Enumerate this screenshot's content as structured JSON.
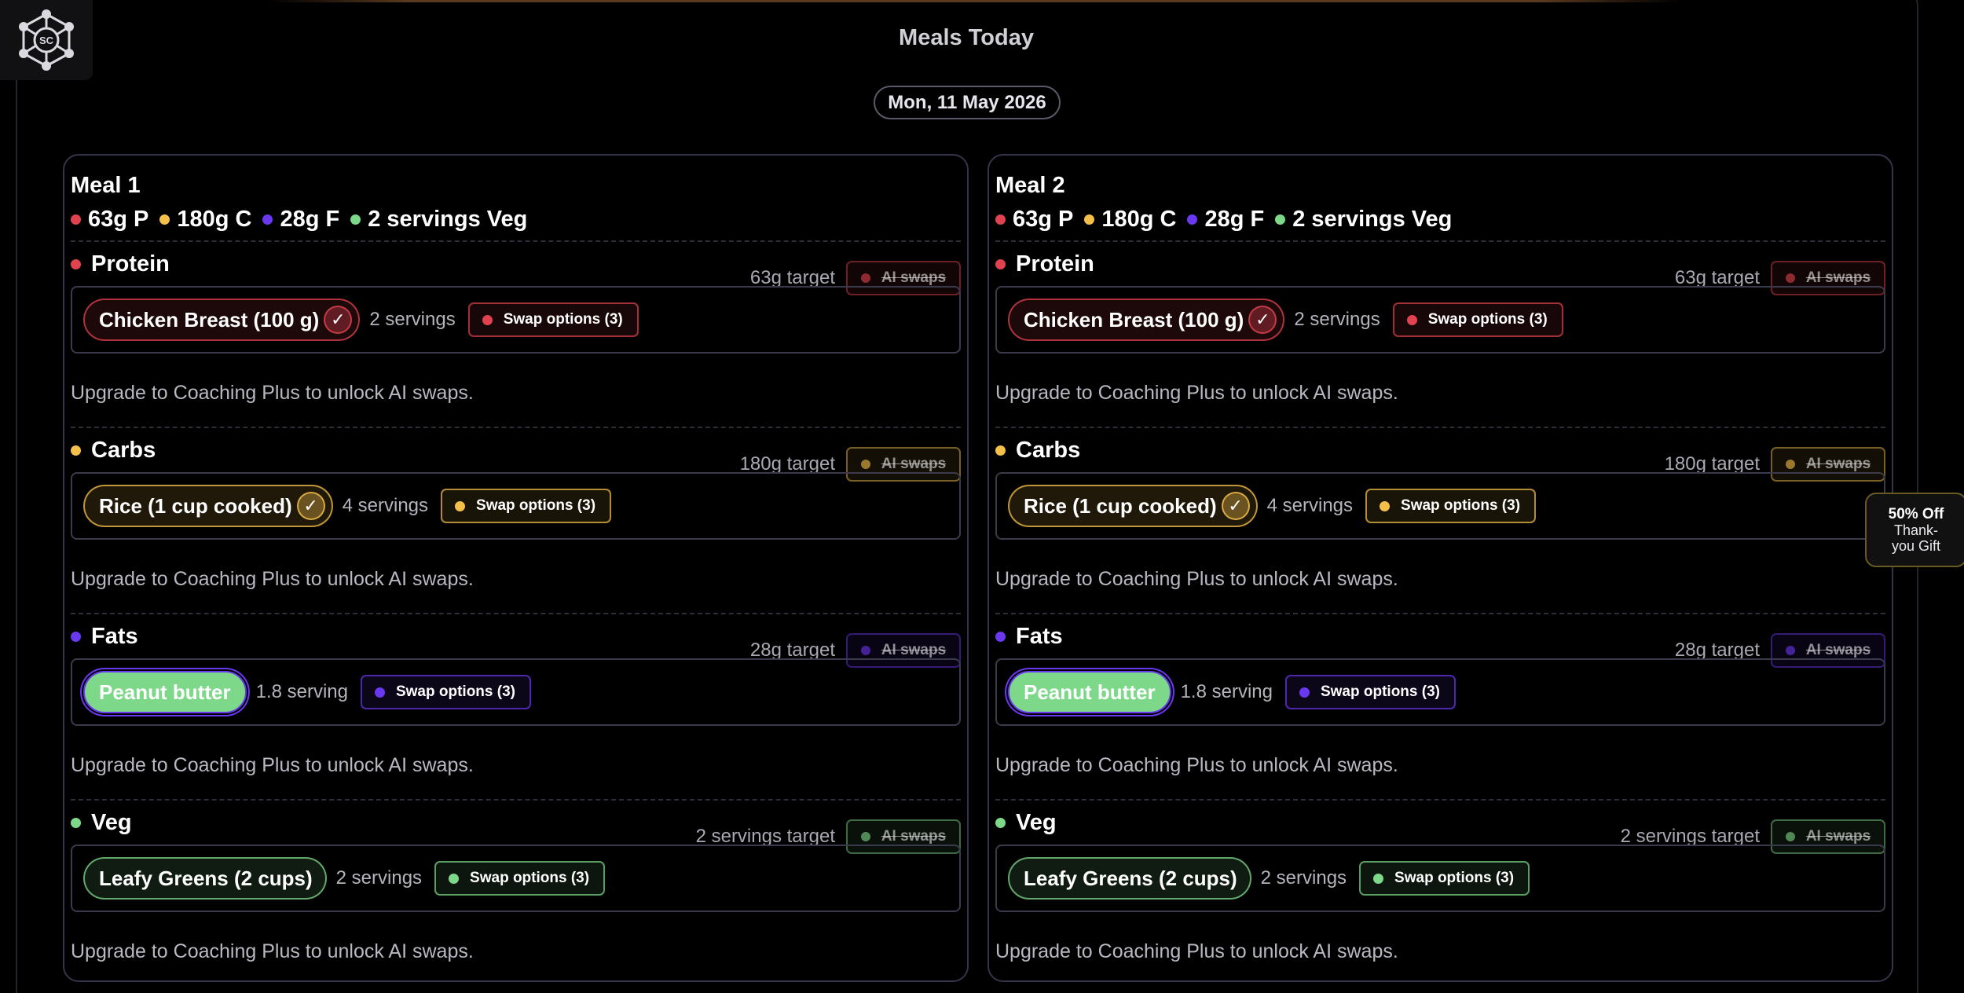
{
  "page": {
    "title": "Meals Today",
    "date": "Mon, 11 May 2026",
    "logo_text": "SC"
  },
  "colors": {
    "protein": "#e0424f",
    "carbs": "#f5c04a",
    "fats": "#6a38f0",
    "veg": "#7ed88a"
  },
  "promo": {
    "line1": "50% Off",
    "line2": "Thank-",
    "line3": "you Gift"
  },
  "meals": [
    {
      "title": "Meal 1",
      "macros": [
        {
          "label": "63g P"
        },
        {
          "label": "180g C"
        },
        {
          "label": "28g F"
        },
        {
          "label": "2 servings Veg"
        }
      ],
      "sections": [
        {
          "name": "Protein",
          "target": "63g target",
          "ai_label": "AI swaps",
          "food": "Chicken Breast (100 g)",
          "servings": "2 servings",
          "swap_label": "Swap options (3)",
          "upgrade": "Upgrade to Coaching Plus to unlock AI swaps."
        },
        {
          "name": "Carbs",
          "target": "180g target",
          "ai_label": "AI swaps",
          "food": "Rice (1 cup cooked)",
          "servings": "4 servings",
          "swap_label": "Swap options (3)",
          "upgrade": "Upgrade to Coaching Plus to unlock AI swaps."
        },
        {
          "name": "Fats",
          "target": "28g target",
          "ai_label": "AI swaps",
          "food": "Peanut butter",
          "servings": "1.8 serving",
          "swap_label": "Swap options (3)",
          "upgrade": "Upgrade to Coaching Plus to unlock AI swaps."
        },
        {
          "name": "Veg",
          "target": "2 servings target",
          "ai_label": "AI swaps",
          "food": "Leafy Greens (2 cups)",
          "servings": "2 servings",
          "swap_label": "Swap options (3)",
          "upgrade": "Upgrade to Coaching Plus to unlock AI swaps."
        }
      ]
    },
    {
      "title": "Meal 2",
      "macros": [
        {
          "label": "63g P"
        },
        {
          "label": "180g C"
        },
        {
          "label": "28g F"
        },
        {
          "label": "2 servings Veg"
        }
      ],
      "sections": [
        {
          "name": "Protein",
          "target": "63g target",
          "ai_label": "AI swaps",
          "food": "Chicken Breast (100 g)",
          "servings": "2 servings",
          "swap_label": "Swap options (3)",
          "upgrade": "Upgrade to Coaching Plus to unlock AI swaps."
        },
        {
          "name": "Carbs",
          "target": "180g target",
          "ai_label": "AI swaps",
          "food": "Rice (1 cup cooked)",
          "servings": "4 servings",
          "swap_label": "Swap options (3)",
          "upgrade": "Upgrade to Coaching Plus to unlock AI swaps."
        },
        {
          "name": "Fats",
          "target": "28g target",
          "ai_label": "AI swaps",
          "food": "Peanut butter",
          "servings": "1.8 serving",
          "swap_label": "Swap options (3)",
          "upgrade": "Upgrade to Coaching Plus to unlock AI swaps."
        },
        {
          "name": "Veg",
          "target": "2 servings target",
          "ai_label": "AI swaps",
          "food": "Leafy Greens (2 cups)",
          "servings": "2 servings",
          "swap_label": "Swap options (3)",
          "upgrade": "Upgrade to Coaching Plus to unlock AI swaps."
        }
      ]
    }
  ]
}
